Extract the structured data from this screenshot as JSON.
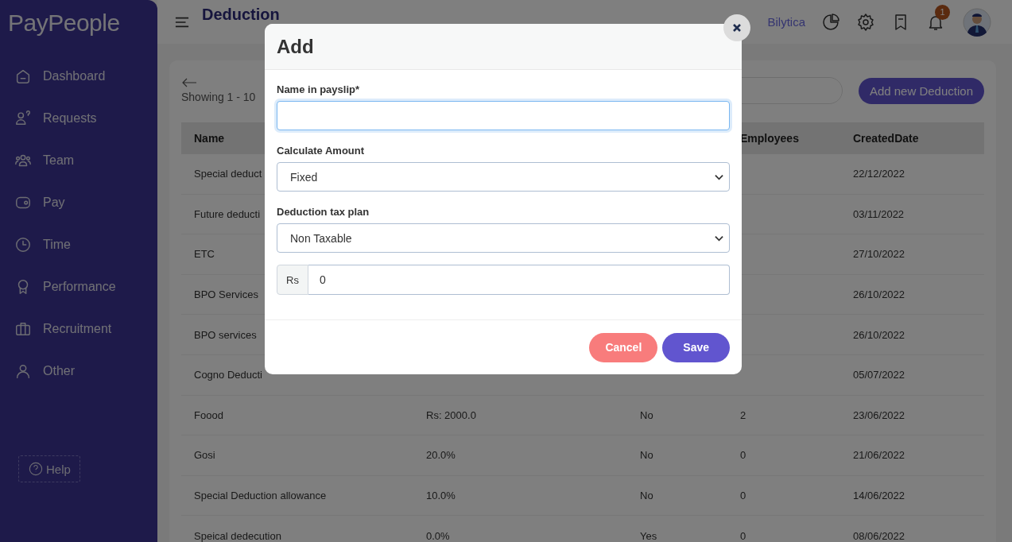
{
  "sidebar": {
    "logo": "PayPeople",
    "items": [
      {
        "label": "Dashboard"
      },
      {
        "label": "Requests"
      },
      {
        "label": "Team"
      },
      {
        "label": "Pay"
      },
      {
        "label": "Time"
      },
      {
        "label": "Performance"
      },
      {
        "label": "Recruitment"
      },
      {
        "label": "Other"
      }
    ],
    "help": "Help"
  },
  "topbar": {
    "title": "Deduction",
    "company": "Bilytica",
    "notification_badge": "1"
  },
  "toolbar": {
    "showing": "Showing 1 - 10",
    "add_button": "Add new Deduction"
  },
  "table": {
    "columns": [
      {
        "label": "Name"
      },
      {},
      {},
      {
        "label": "Employees"
      },
      {
        "label": "CreatedDate"
      }
    ],
    "rows": [
      {
        "name": "Special deduct",
        "created": "22/12/2022"
      },
      {
        "name": "Future deducti",
        "created": "03/11/2022"
      },
      {
        "name": "ETC",
        "created": "27/10/2022"
      },
      {
        "name": "BPO Services",
        "created": "26/10/2022"
      },
      {
        "name": "BPO services",
        "created": "26/10/2022"
      },
      {
        "name": "Cogno Deducti",
        "created": "05/07/2022"
      },
      {
        "name": "Foood",
        "amount": "Rs: 2000.0",
        "taxable": "No",
        "employees": "2",
        "created": "23/06/2022"
      },
      {
        "name": "Gosi",
        "amount": "20.0%",
        "taxable": "No",
        "employees": "0",
        "created": "21/06/2022"
      },
      {
        "name": "Special Deduction allowance",
        "amount": "10.0%",
        "taxable": "No",
        "employees": "0",
        "created": "14/06/2022"
      },
      {
        "name": "Speical dedecution",
        "amount": "0.0%",
        "taxable": "Yes",
        "employees": "0",
        "created": "08/06/2022"
      }
    ]
  },
  "modal": {
    "title": "Add",
    "fields": [
      {
        "kind": "text",
        "label": "Name in payslip*",
        "focused": true
      },
      {
        "kind": "select",
        "label": "Calculate Amount",
        "value": "Fixed",
        "focused": false
      },
      {
        "kind": "select",
        "label": "Deduction tax plan",
        "value": "Non Taxable",
        "focused": false
      },
      {
        "kind": "addon",
        "addon": "Rs",
        "value": "0",
        "focused": false
      }
    ],
    "buttons": [
      {
        "kind": "cancel",
        "label": "Cancel"
      },
      {
        "kind": "save",
        "label": "Save"
      }
    ]
  }
}
